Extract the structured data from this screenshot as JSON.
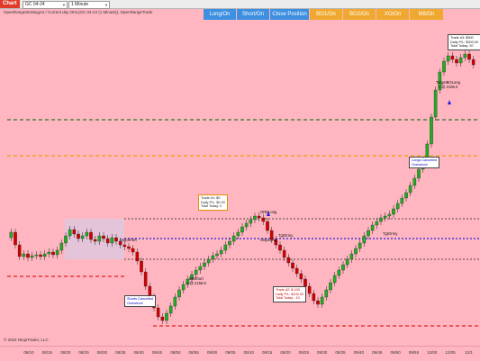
{
  "toolbar": {
    "chart_tab": "Chart",
    "instrument": "GC 04-24",
    "timeframe": "1 Minute"
  },
  "subtitle": "OpenRangeStrategyAI / Current day OHL(GC 04-24 (1 Minute)), OpenRangeTrade",
  "buttons": [
    {
      "label": "Long/On",
      "color": "#3d8fe0"
    },
    {
      "label": "Short/On",
      "color": "#3d8fe0"
    },
    {
      "label": "Close Position",
      "color": "#3d8fe0"
    },
    {
      "label": "BO1/On",
      "color": "#f0a830"
    },
    {
      "label": "BO2/On",
      "color": "#f0a830"
    },
    {
      "label": "XO/On",
      "color": "#f0a830"
    },
    {
      "label": "M8/On",
      "color": "#f0a830"
    }
  ],
  "x_axis_ticks": [
    "08/10",
    "08/15",
    "08/20",
    "08/25",
    "08/30",
    "08/35",
    "08/40",
    "08/45",
    "08/50",
    "08/55",
    "09/00",
    "09/05",
    "09/10",
    "09/15",
    "09/20",
    "09/25",
    "09/30",
    "09/35",
    "09/40",
    "09/45",
    "09/50",
    "09/55",
    "12/00",
    "12/05",
    "12/1"
  ],
  "copyright": "© 2024 NinjaTrader, LLC",
  "colors": {
    "background": "#ffb6c1",
    "up_candle": "#22aa22",
    "down_candle": "#d00000",
    "level_green": "#2a7a2a",
    "level_orange": "#e8a000",
    "level_blue": "#2020e0",
    "level_red": "#e02020",
    "opening_range": "#d9c8e0"
  },
  "annotations": {
    "trade1": {
      "line1": "Trade #1: $0",
      "line2": "Daily P/L: $0.00",
      "line3": "Total Today: 0"
    },
    "trade2": {
      "line1": "Trade #2: $-100",
      "line2": "Daily P/L: $100.00",
      "line3": "Total Today: -10"
    },
    "trade3": {
      "line1": "Trade #3: $300",
      "line2": "Daily P/L: $300.00",
      "line3": "Total Today: 20"
    },
    "short_cancelled": {
      "line1": "Shorts Cancelled",
      "line2": "Overshoot"
    },
    "long_cancelled": {
      "line1": "Longs Cancelled",
      "line2": "Overshoot"
    },
    "orb_short": {
      "line1": "ORBShort",
      "line2": "1 @ 2155.8"
    },
    "orb_long": {
      "line1": "ORBLong",
      "line2": "1 @ 2159.8"
    },
    "target_long": {
      "line1": "TargetBOLong",
      "line2": "1 @ 2165.0"
    },
    "orb_short_entry": {
      "line1": "BDShort",
      "line2": "1 @ 2155.8"
    },
    "stop_short": "StopShort",
    "stop_long": "StopLong",
    "tp_label": "TgtOrmy",
    "tp_label2": "TgtOrmy"
  }
}
